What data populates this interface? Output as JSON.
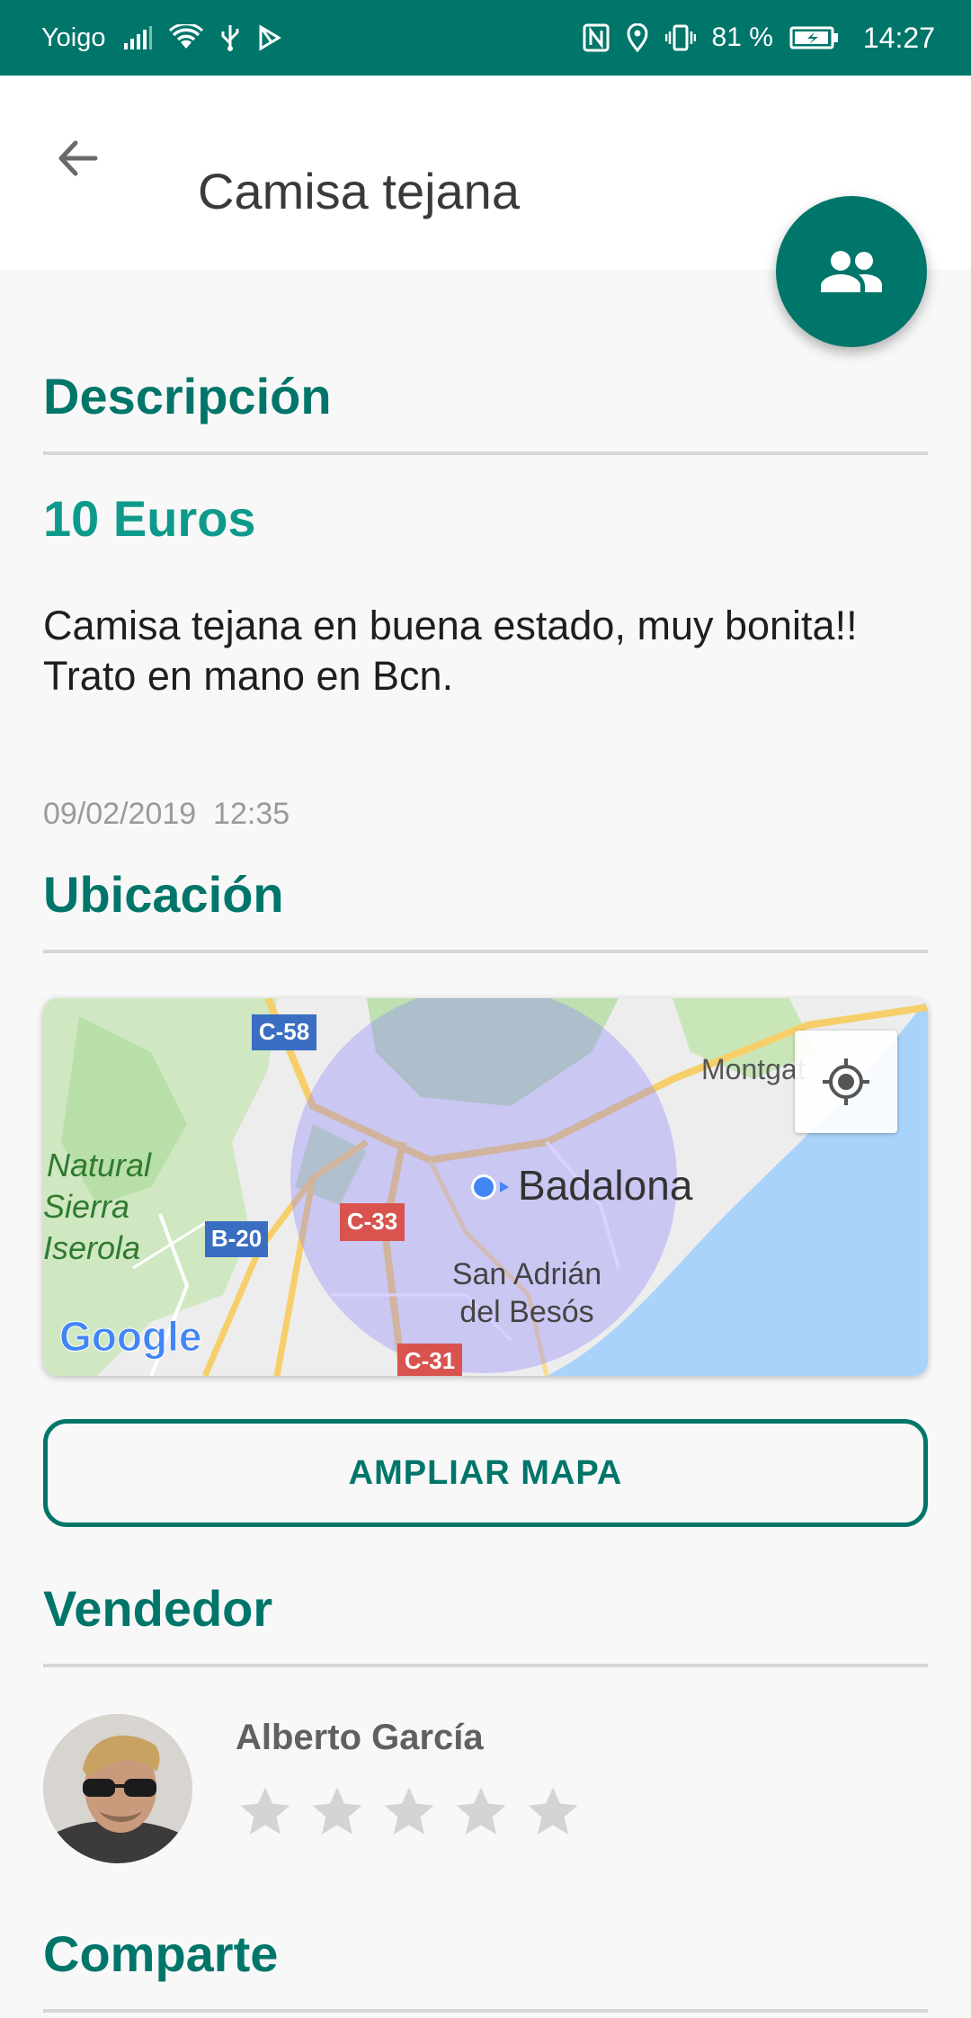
{
  "status_bar": {
    "carrier": "Yoigo",
    "battery": "81 %",
    "time": "14:27"
  },
  "header": {
    "title": "Camisa tejana"
  },
  "sections": {
    "description": "Descripción",
    "location": "Ubicación",
    "seller": "Vendedor",
    "share": "Comparte"
  },
  "listing": {
    "price": "10 Euros",
    "description": "Camisa tejana en buena estado, muy bonita!! Trato en mano en Bcn.",
    "date": "09/02/2019  12:35"
  },
  "map": {
    "labels": {
      "badalona": "Badalona",
      "montgat": "Montgat",
      "natural_1": "Natural",
      "natural_2": "Sierra",
      "natural_3": "Iserola",
      "san_adrian_1": "San Adrián",
      "san_adrian_2": "del Besós",
      "road_c58": "C-58",
      "road_b20": "B-20",
      "road_c33": "C-33",
      "road_c31": "C-31",
      "google": "Google"
    },
    "expand_button": "AMPLIAR MAPA"
  },
  "seller": {
    "name": "Alberto García",
    "rating": 0,
    "max_rating": 5
  },
  "colors": {
    "primary": "#00756a",
    "price": "#0e9a8a",
    "star_empty": "#d4d4d4"
  }
}
